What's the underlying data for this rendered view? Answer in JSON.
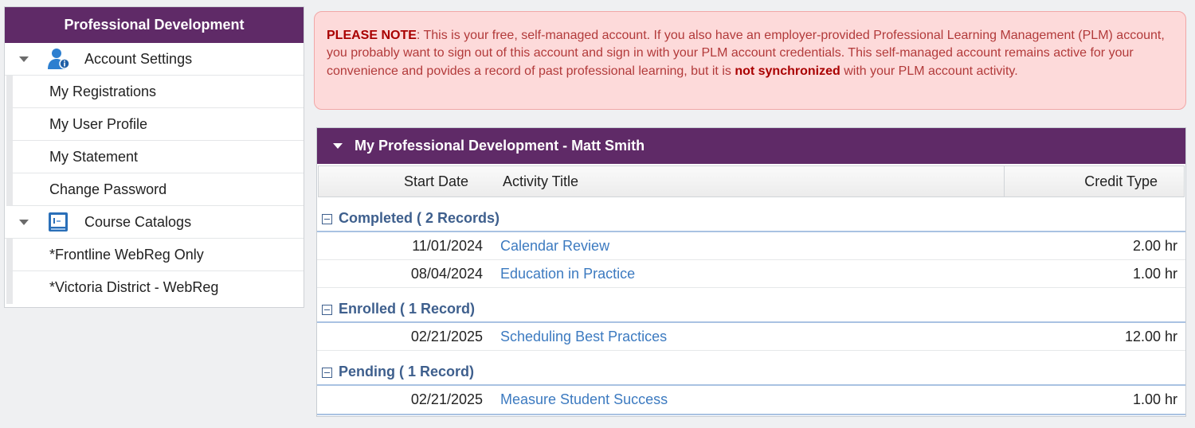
{
  "sidebar": {
    "title": "Professional Development",
    "groups": [
      {
        "label": "Account Settings",
        "icon": "user-info-icon",
        "items": [
          {
            "label": "My Registrations"
          },
          {
            "label": "My User Profile"
          },
          {
            "label": "My Statement"
          },
          {
            "label": "Change Password"
          }
        ]
      },
      {
        "label": "Course Catalogs",
        "icon": "catalog-book-icon",
        "items": [
          {
            "label": "*Frontline WebReg Only"
          },
          {
            "label": "*Victoria District - WebReg"
          }
        ]
      }
    ]
  },
  "note": {
    "prefix": "PLEASE NOTE",
    "text_1": ": This is your free, self-managed account. If you also have an employer-provided Professional Learning Management (PLM) account, you probably want to sign out of this account and sign in with your PLM account credentials. This self-managed account remains active for your convenience and povides a record of past professional learning, but it is ",
    "emphasis": "not synchronized",
    "text_2": " with your PLM account activity."
  },
  "panel": {
    "title": "My Professional Development - Matt Smith",
    "columns": {
      "start_date": "Start Date",
      "activity_title": "Activity Title",
      "credit_type": "Credit Type"
    },
    "groups": [
      {
        "label": "Completed ( 2 Records)",
        "rows": [
          {
            "date": "11/01/2024",
            "title": "Calendar Review",
            "credit": "2.00 hr"
          },
          {
            "date": "08/04/2024",
            "title": "Education in Practice",
            "credit": "1.00 hr"
          }
        ]
      },
      {
        "label": "Enrolled ( 1 Record)",
        "rows": [
          {
            "date": "02/21/2025",
            "title": "Scheduling Best Practices",
            "credit": "12.00 hr"
          }
        ]
      },
      {
        "label": "Pending ( 1 Record)",
        "rows": [
          {
            "date": "02/21/2025",
            "title": "Measure Student Success",
            "credit": "1.00 hr"
          }
        ]
      }
    ]
  },
  "colors": {
    "header_purple": "#5f2a67",
    "note_background": "#fddada",
    "link_blue": "#3c7ac0",
    "group_blue": "#3e5f8d"
  }
}
